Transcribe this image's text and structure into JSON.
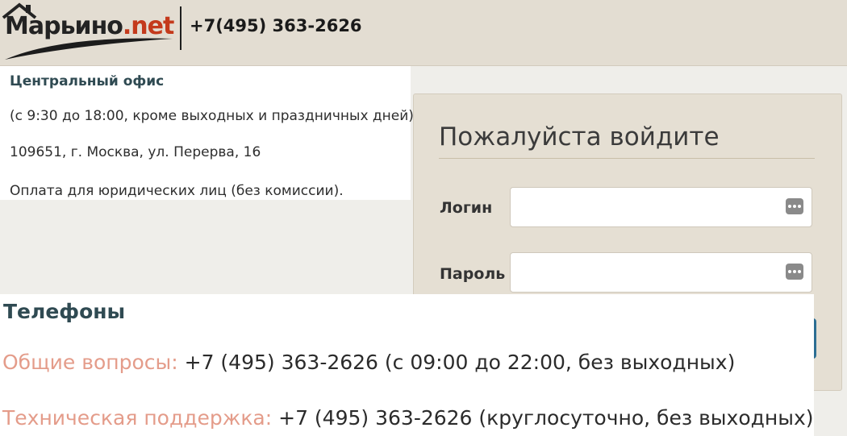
{
  "header": {
    "logo_main": "Марьино",
    "logo_tld": ".net",
    "phone": "+7(495) 363-2626"
  },
  "office": {
    "title": "Центральный офис",
    "hours": "(с 9:30 до 18:00, кроме выходных и праздничных дней)",
    "address": "109651, г. Москва, ул. Перерва, 16",
    "payment": "Оплата для юридических лиц (без комиссии)."
  },
  "login": {
    "title": "Пожалуйста войдите",
    "login_label": "Логин",
    "password_label": "Пароль",
    "login_value": "",
    "password_value": "",
    "field_icon": "password-manager-key-icon"
  },
  "phones": {
    "title": "Телефоны",
    "general_label": "Общие вопросы:",
    "general_value": "+7 (495) 363-2626 (с 09:00 до 22:00, без выходных)",
    "support_label": "Техническая поддержка:",
    "support_value": "+7 (495) 363-2626 (круглосуточно, без выходных)"
  },
  "colors": {
    "header_bg": "#e3ddd2",
    "login_panel_bg": "#e5dfd3",
    "heading_teal": "#2f4a52",
    "phone_label_pink": "#e49c8a",
    "logo_red": "#c43a1c",
    "button_blue": "#2c6e93"
  }
}
